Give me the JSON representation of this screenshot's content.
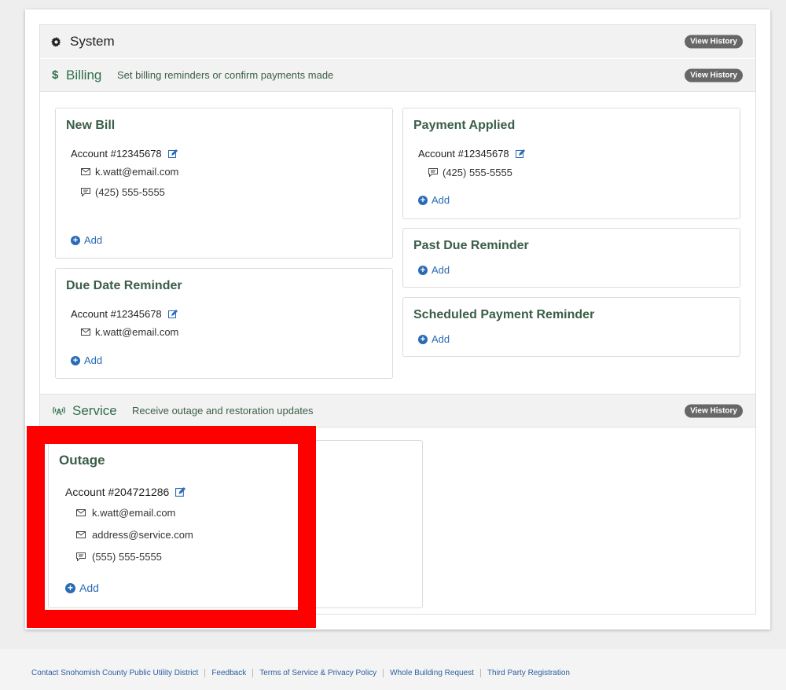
{
  "system": {
    "title": "System",
    "view_history": "View History"
  },
  "billing": {
    "title": "Billing",
    "description": "Set billing reminders or confirm payments made",
    "view_history": "View History",
    "cards": {
      "new_bill": {
        "title": "New Bill",
        "account": "Account #12345678",
        "email": "k.watt@email.com",
        "phone": "(425) 555-5555",
        "add": "Add"
      },
      "payment_applied": {
        "title": "Payment Applied",
        "account": "Account #12345678",
        "phone": "(425) 555-5555",
        "add": "Add"
      },
      "past_due": {
        "title": "Past Due Reminder",
        "add": "Add"
      },
      "due_date": {
        "title": "Due Date Reminder",
        "account": "Account #12345678",
        "email": "k.watt@email.com",
        "add": "Add"
      },
      "scheduled_payment": {
        "title": "Scheduled Payment Reminder",
        "add": "Add"
      }
    }
  },
  "service": {
    "title": "Service",
    "description": "Receive outage and restoration updates",
    "view_history": "View History",
    "outage": {
      "title": "Outage",
      "account": "Account #204721286",
      "email": "k.watt@email.com",
      "email2": "address@service.com",
      "phone": "(555) 555-5555",
      "add": "Add"
    }
  },
  "footer": {
    "links": [
      "Contact Snohomish County Public Utility District",
      "Feedback",
      "Terms of Service & Privacy Policy",
      "Whole Building Request",
      "Third Party Registration"
    ]
  },
  "colors": {
    "accent_green": "#2f6f4a",
    "link_blue": "#2a6bb5",
    "highlight_red": "#ff0000"
  }
}
